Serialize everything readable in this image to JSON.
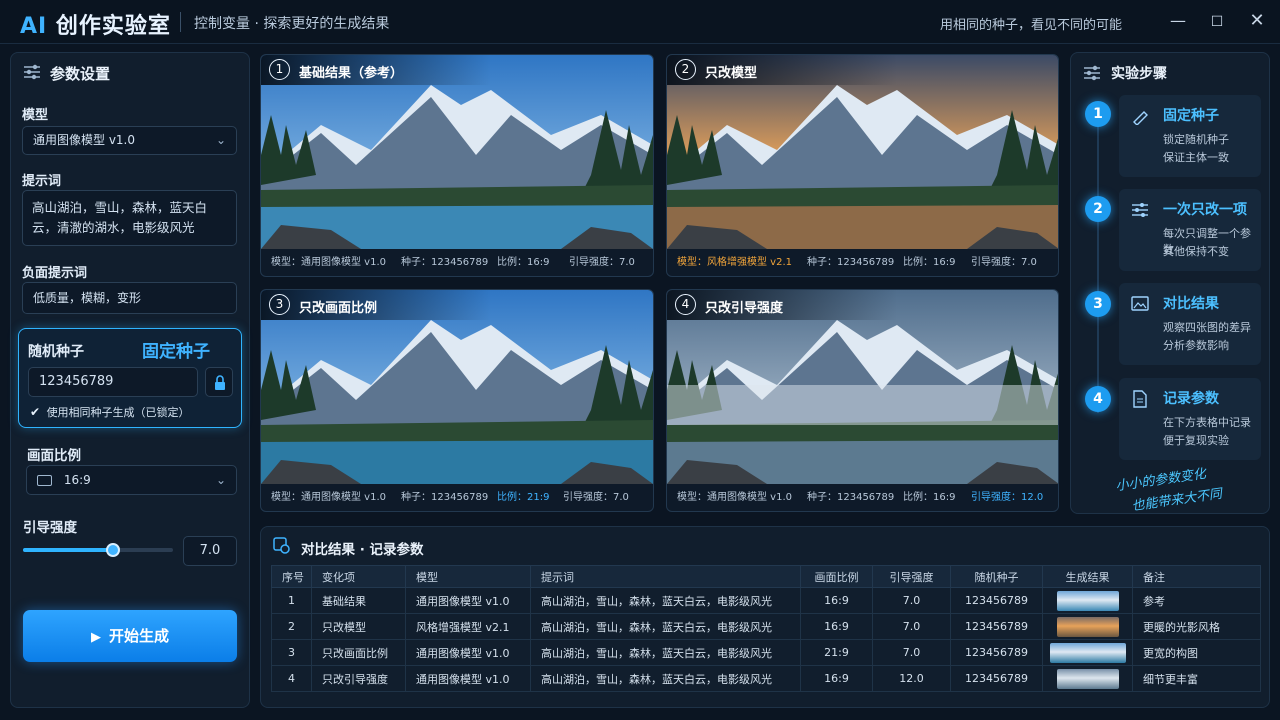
{
  "header": {
    "title_ai": "AI",
    "title_rest": "创作实验室",
    "subtitle": "控制变量 · 探索更好的生成结果",
    "tagline": "用相同的种子，看见不同的可能",
    "minimize_icon": "minimize-icon",
    "maximize_icon": "maximize-icon",
    "close_icon": "close-icon"
  },
  "settings": {
    "title": "参数设置",
    "model_label": "模型",
    "model_value": "通用图像模型 v1.0",
    "prompt_label": "提示词",
    "prompt_value": "高山湖泊，雪山，森林，蓝天白云，清澈的湖水，电影级风光",
    "negative_label": "负面提示词",
    "negative_value": "低质量，模糊，变形",
    "seed_label": "随机种子",
    "seed_badge": "固定种子",
    "seed_value": "123456789",
    "seed_lock_note": "使用相同种子生成（已锁定）",
    "ratio_label": "画面比例",
    "ratio_value": "16:9",
    "guidance_label": "引导强度",
    "guidance_value": "7.0",
    "guidance_level": 0.6,
    "generate_label": "开始生成"
  },
  "cards": [
    {
      "num": "1",
      "title": "基础结果（参考）",
      "model": "模型：通用图像模型 v1.0",
      "seed": "种子：123456789",
      "ratio": "比例：16:9",
      "guidance": "引导强度：7.0"
    },
    {
      "num": "2",
      "title": "只改模型",
      "model": "模型：风格增强模型 v2.1",
      "seed": "种子：123456789",
      "ratio": "比例：16:9",
      "guidance": "引导强度：7.0"
    },
    {
      "num": "3",
      "title": "只改画面比例",
      "model": "模型：通用图像模型 v1.0",
      "seed": "种子：123456789",
      "ratio": "比例：21:9",
      "guidance": "引导强度：7.0"
    },
    {
      "num": "4",
      "title": "只改引导强度",
      "model": "模型：通用图像模型 v1.0",
      "seed": "种子：123456789",
      "ratio": "比例：16:9",
      "guidance": "引导强度：12.0"
    }
  ],
  "steps": {
    "title": "实验步骤",
    "items": [
      {
        "num": "1",
        "title": "固定种子",
        "d1": "锁定随机种子",
        "d2": "保证主体一致"
      },
      {
        "num": "2",
        "title": "一次只改一项",
        "d1": "每次只调整一个参数",
        "d2": "其他保持不变"
      },
      {
        "num": "3",
        "title": "对比结果",
        "d1": "观察四张图的差异",
        "d2": "分析参数影响"
      },
      {
        "num": "4",
        "title": "记录参数",
        "d1": "在下方表格中记录",
        "d2": "便于复现实验"
      }
    ],
    "slogan_1": "小小的参数变化",
    "slogan_2": "也能带来大不同"
  },
  "table": {
    "title": "对比结果 · 记录参数",
    "headers": [
      "序号",
      "变化项",
      "模型",
      "提示词",
      "画面比例",
      "引导强度",
      "随机种子",
      "生成结果",
      "备注"
    ],
    "rows": [
      [
        "1",
        "基础结果",
        "通用图像模型 v1.0",
        "高山湖泊，雪山，森林，蓝天白云，电影级风光",
        "16:9",
        "7.0",
        "123456789",
        "",
        "参考"
      ],
      [
        "2",
        "只改模型",
        "风格增强模型 v2.1",
        "高山湖泊，雪山，森林，蓝天白云，电影级风光",
        "16:9",
        "7.0",
        "123456789",
        "",
        "更暖的光影风格"
      ],
      [
        "3",
        "只改画面比例",
        "通用图像模型 v1.0",
        "高山湖泊，雪山，森林，蓝天白云，电影级风光",
        "21:9",
        "7.0",
        "123456789",
        "",
        "更宽的构图"
      ],
      [
        "4",
        "只改引导强度",
        "通用图像模型 v1.0",
        "高山湖泊，雪山，森林，蓝天白云，电影级风光",
        "16:9",
        "12.0",
        "123456789",
        "",
        "细节更丰富"
      ]
    ]
  },
  "colors": {
    "accent": "#2fb4ff",
    "orange": "#f0a43a",
    "bg": "#0b1522"
  }
}
